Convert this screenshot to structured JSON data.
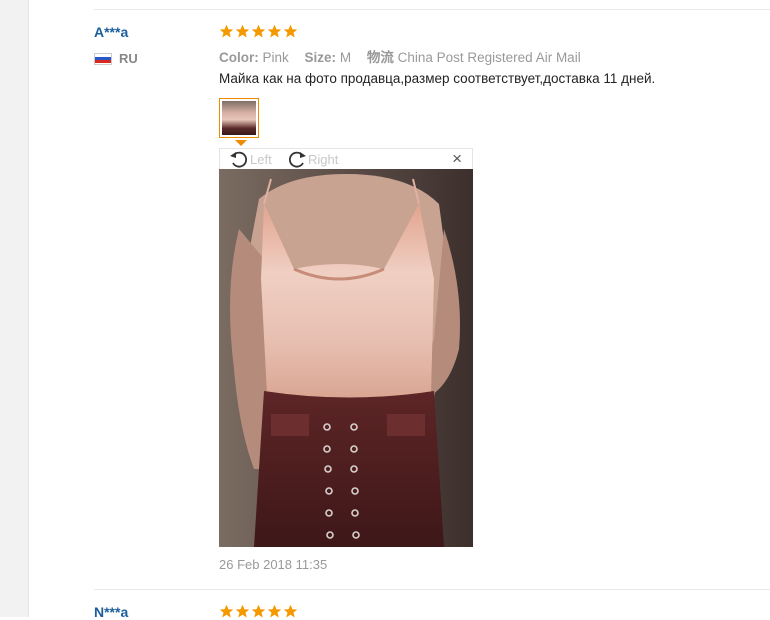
{
  "reviews": [
    {
      "user": "A***a",
      "country": "RU",
      "rating": 5,
      "color_label": "Color:",
      "color_value": "Pink",
      "size_label": "Size:",
      "size_value": "M",
      "shipping_label": "物流",
      "shipping_value": "China Post Registered Air Mail",
      "text": "Майка как на фото продавца,размер соответствует,доставка 11 дней.",
      "date": "26 Feb 2018 11:35"
    },
    {
      "user": "N***a",
      "rating": 5
    }
  ],
  "viewer": {
    "rotate_left_label": "Left",
    "rotate_right_label": "Right",
    "close_label": "×"
  },
  "colors": {
    "star": "#f49a00",
    "username": "#1c5e9c",
    "thumb_border": "#f08a00"
  }
}
